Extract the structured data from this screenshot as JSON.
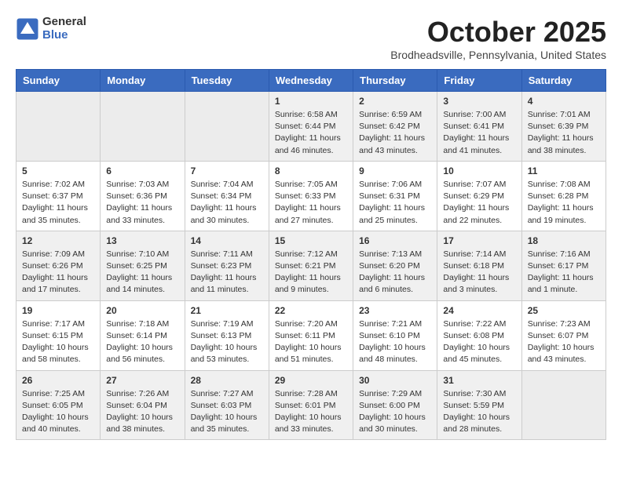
{
  "header": {
    "logo_general": "General",
    "logo_blue": "Blue",
    "month": "October 2025",
    "location": "Brodheadsville, Pennsylvania, United States"
  },
  "weekdays": [
    "Sunday",
    "Monday",
    "Tuesday",
    "Wednesday",
    "Thursday",
    "Friday",
    "Saturday"
  ],
  "weeks": [
    [
      {
        "day": "",
        "sunrise": "",
        "sunset": "",
        "daylight": "",
        "empty": true
      },
      {
        "day": "",
        "sunrise": "",
        "sunset": "",
        "daylight": "",
        "empty": true
      },
      {
        "day": "",
        "sunrise": "",
        "sunset": "",
        "daylight": "",
        "empty": true
      },
      {
        "day": "1",
        "sunrise": "Sunrise: 6:58 AM",
        "sunset": "Sunset: 6:44 PM",
        "daylight": "Daylight: 11 hours and 46 minutes."
      },
      {
        "day": "2",
        "sunrise": "Sunrise: 6:59 AM",
        "sunset": "Sunset: 6:42 PM",
        "daylight": "Daylight: 11 hours and 43 minutes."
      },
      {
        "day": "3",
        "sunrise": "Sunrise: 7:00 AM",
        "sunset": "Sunset: 6:41 PM",
        "daylight": "Daylight: 11 hours and 41 minutes."
      },
      {
        "day": "4",
        "sunrise": "Sunrise: 7:01 AM",
        "sunset": "Sunset: 6:39 PM",
        "daylight": "Daylight: 11 hours and 38 minutes."
      }
    ],
    [
      {
        "day": "5",
        "sunrise": "Sunrise: 7:02 AM",
        "sunset": "Sunset: 6:37 PM",
        "daylight": "Daylight: 11 hours and 35 minutes."
      },
      {
        "day": "6",
        "sunrise": "Sunrise: 7:03 AM",
        "sunset": "Sunset: 6:36 PM",
        "daylight": "Daylight: 11 hours and 33 minutes."
      },
      {
        "day": "7",
        "sunrise": "Sunrise: 7:04 AM",
        "sunset": "Sunset: 6:34 PM",
        "daylight": "Daylight: 11 hours and 30 minutes."
      },
      {
        "day": "8",
        "sunrise": "Sunrise: 7:05 AM",
        "sunset": "Sunset: 6:33 PM",
        "daylight": "Daylight: 11 hours and 27 minutes."
      },
      {
        "day": "9",
        "sunrise": "Sunrise: 7:06 AM",
        "sunset": "Sunset: 6:31 PM",
        "daylight": "Daylight: 11 hours and 25 minutes."
      },
      {
        "day": "10",
        "sunrise": "Sunrise: 7:07 AM",
        "sunset": "Sunset: 6:29 PM",
        "daylight": "Daylight: 11 hours and 22 minutes."
      },
      {
        "day": "11",
        "sunrise": "Sunrise: 7:08 AM",
        "sunset": "Sunset: 6:28 PM",
        "daylight": "Daylight: 11 hours and 19 minutes."
      }
    ],
    [
      {
        "day": "12",
        "sunrise": "Sunrise: 7:09 AM",
        "sunset": "Sunset: 6:26 PM",
        "daylight": "Daylight: 11 hours and 17 minutes."
      },
      {
        "day": "13",
        "sunrise": "Sunrise: 7:10 AM",
        "sunset": "Sunset: 6:25 PM",
        "daylight": "Daylight: 11 hours and 14 minutes."
      },
      {
        "day": "14",
        "sunrise": "Sunrise: 7:11 AM",
        "sunset": "Sunset: 6:23 PM",
        "daylight": "Daylight: 11 hours and 11 minutes."
      },
      {
        "day": "15",
        "sunrise": "Sunrise: 7:12 AM",
        "sunset": "Sunset: 6:21 PM",
        "daylight": "Daylight: 11 hours and 9 minutes."
      },
      {
        "day": "16",
        "sunrise": "Sunrise: 7:13 AM",
        "sunset": "Sunset: 6:20 PM",
        "daylight": "Daylight: 11 hours and 6 minutes."
      },
      {
        "day": "17",
        "sunrise": "Sunrise: 7:14 AM",
        "sunset": "Sunset: 6:18 PM",
        "daylight": "Daylight: 11 hours and 3 minutes."
      },
      {
        "day": "18",
        "sunrise": "Sunrise: 7:16 AM",
        "sunset": "Sunset: 6:17 PM",
        "daylight": "Daylight: 11 hours and 1 minute."
      }
    ],
    [
      {
        "day": "19",
        "sunrise": "Sunrise: 7:17 AM",
        "sunset": "Sunset: 6:15 PM",
        "daylight": "Daylight: 10 hours and 58 minutes."
      },
      {
        "day": "20",
        "sunrise": "Sunrise: 7:18 AM",
        "sunset": "Sunset: 6:14 PM",
        "daylight": "Daylight: 10 hours and 56 minutes."
      },
      {
        "day": "21",
        "sunrise": "Sunrise: 7:19 AM",
        "sunset": "Sunset: 6:13 PM",
        "daylight": "Daylight: 10 hours and 53 minutes."
      },
      {
        "day": "22",
        "sunrise": "Sunrise: 7:20 AM",
        "sunset": "Sunset: 6:11 PM",
        "daylight": "Daylight: 10 hours and 51 minutes."
      },
      {
        "day": "23",
        "sunrise": "Sunrise: 7:21 AM",
        "sunset": "Sunset: 6:10 PM",
        "daylight": "Daylight: 10 hours and 48 minutes."
      },
      {
        "day": "24",
        "sunrise": "Sunrise: 7:22 AM",
        "sunset": "Sunset: 6:08 PM",
        "daylight": "Daylight: 10 hours and 45 minutes."
      },
      {
        "day": "25",
        "sunrise": "Sunrise: 7:23 AM",
        "sunset": "Sunset: 6:07 PM",
        "daylight": "Daylight: 10 hours and 43 minutes."
      }
    ],
    [
      {
        "day": "26",
        "sunrise": "Sunrise: 7:25 AM",
        "sunset": "Sunset: 6:05 PM",
        "daylight": "Daylight: 10 hours and 40 minutes."
      },
      {
        "day": "27",
        "sunrise": "Sunrise: 7:26 AM",
        "sunset": "Sunset: 6:04 PM",
        "daylight": "Daylight: 10 hours and 38 minutes."
      },
      {
        "day": "28",
        "sunrise": "Sunrise: 7:27 AM",
        "sunset": "Sunset: 6:03 PM",
        "daylight": "Daylight: 10 hours and 35 minutes."
      },
      {
        "day": "29",
        "sunrise": "Sunrise: 7:28 AM",
        "sunset": "Sunset: 6:01 PM",
        "daylight": "Daylight: 10 hours and 33 minutes."
      },
      {
        "day": "30",
        "sunrise": "Sunrise: 7:29 AM",
        "sunset": "Sunset: 6:00 PM",
        "daylight": "Daylight: 10 hours and 30 minutes."
      },
      {
        "day": "31",
        "sunrise": "Sunrise: 7:30 AM",
        "sunset": "Sunset: 5:59 PM",
        "daylight": "Daylight: 10 hours and 28 minutes."
      },
      {
        "day": "",
        "sunrise": "",
        "sunset": "",
        "daylight": "",
        "empty": true
      }
    ]
  ]
}
